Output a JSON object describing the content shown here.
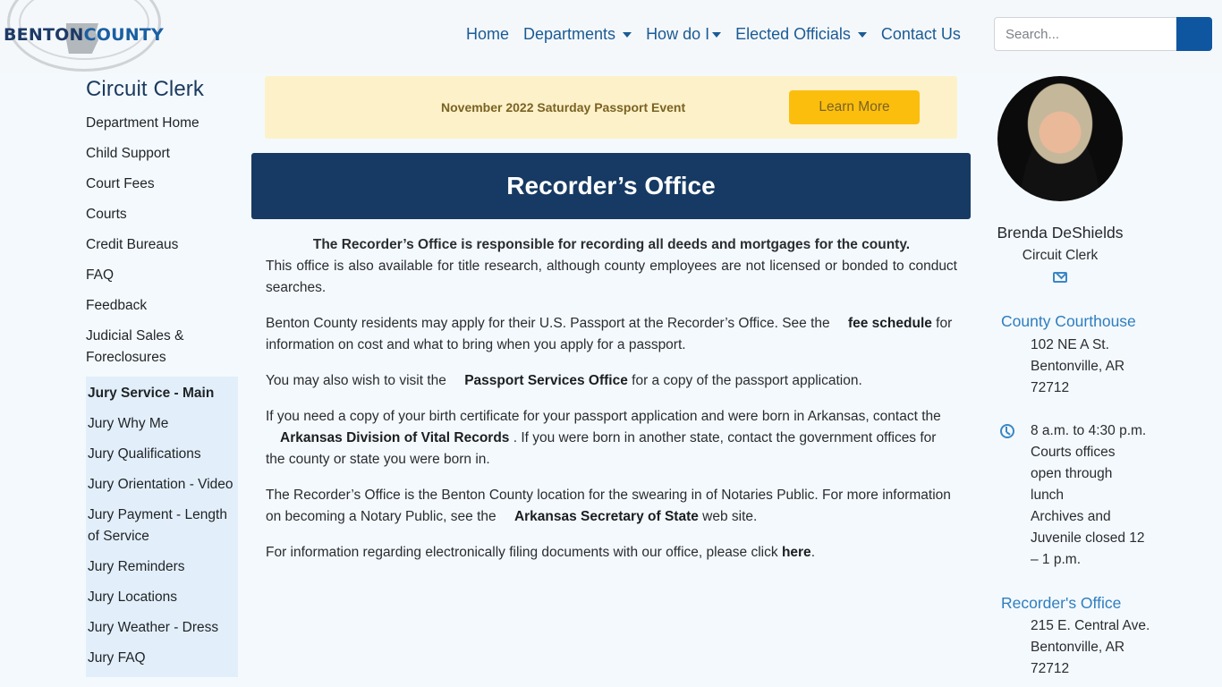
{
  "header": {
    "logo": {
      "word1": "BENTON",
      "word2": "COUNTY"
    },
    "nav": [
      {
        "label": "Home",
        "dropdown": false
      },
      {
        "label": "Departments",
        "dropdown": true
      },
      {
        "label": "How do I",
        "dropdown": true
      },
      {
        "label": "Elected Officials",
        "dropdown": true
      },
      {
        "label": "Contact Us",
        "dropdown": false
      }
    ],
    "search": {
      "placeholder": "Search...",
      "value": ""
    }
  },
  "sidebar": {
    "title": "Circuit Clerk",
    "items": [
      "Department Home",
      "Child Support",
      "Court Fees",
      "Courts",
      "Credit Bureaus",
      "FAQ",
      "Feedback",
      "Judicial Sales & Foreclosures"
    ],
    "subitems": [
      "Jury Service - Main",
      "Jury Why Me",
      "Jury Qualifications",
      "Jury Orientation - Video",
      "Jury Payment - Length of Service",
      "Jury Reminders",
      "Jury Locations",
      "Jury Weather - Dress",
      "Jury FAQ"
    ],
    "active_subitem": "Jury Service - Main"
  },
  "banner": {
    "text": "November 2022 Saturday Passport Event",
    "button": "Learn More"
  },
  "page": {
    "title": "Recorder’s Office",
    "lead": "The Recorder’s Office is responsible for recording all deeds and mortgages for the county.",
    "p1": "This office is also available for title research, although county employees are not licensed or bonded to conduct searches.",
    "p2_before": "Benton County residents may apply for their U.S. Passport at the Recorder’s Office. See the ",
    "p2_link": "fee schedule",
    "p2_after": " for information on cost and what to bring when you apply for a passport.",
    "p3_before": "You may also wish to visit the ",
    "p3_link": "Passport Services Office",
    "p3_after": " for a copy of the passport application.",
    "p4_before": "If you need a copy of your birth certificate for your passport application and were born in Arkansas, contact the ",
    "p4_link": "Arkansas Division of Vital Records",
    "p4_after": " . If you were born in another state, contact the government offices for the county or state you were born in.",
    "p5_before": "The Recorder’s Office is the Benton County location for the swearing in of Notaries Public. For more information on becoming a Notary Public, see the ",
    "p5_link": "Arkansas Secretary of State",
    "p5_after": " web site.",
    "p6_before": "For information regarding electronically filing documents with our office, please click ",
    "p6_link": "here",
    "p6_after": "."
  },
  "official": {
    "name": "Brenda DeShields",
    "title": "Circuit Clerk",
    "contact_icon": "envelope-icon"
  },
  "locations": [
    {
      "title": "County Courthouse",
      "address": [
        "102 NE A St.",
        "Bentonville, AR",
        "72712"
      ],
      "hours_icon": "clock-icon",
      "hours": [
        "8 a.m. to 4:30 p.m.",
        "Courts offices",
        "open through",
        "lunch",
        "Archives and",
        "Juvenile closed 12",
        "– 1 p.m."
      ]
    },
    {
      "title": "Recorder's Office",
      "address": [
        "215 E. Central Ave.",
        "Bentonville, AR",
        "72712"
      ]
    }
  ],
  "colors": {
    "brand_dark": "#163a63",
    "brand_link": "#1a5b94",
    "search_button": "#0f56a0",
    "banner_bg": "#fdf1c9",
    "banner_button": "#fcbe0d",
    "subnav_bg": "#e2effa",
    "location_title": "#2e7dbf"
  }
}
